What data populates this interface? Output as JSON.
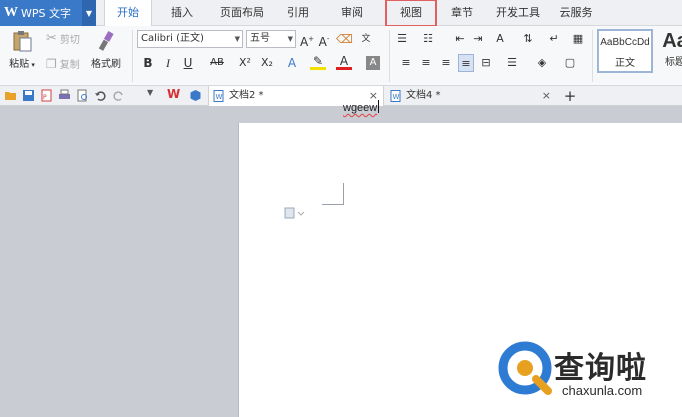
{
  "app": {
    "title": "WPS 文字",
    "logo_letter": "W"
  },
  "menu_tabs": [
    "开始",
    "插入",
    "页面布局",
    "引用",
    "审阅",
    "视图",
    "章节",
    "开发工具",
    "云服务"
  ],
  "active_tab": "开始",
  "highlighted_tab": "视图",
  "ribbon": {
    "paste": "粘贴",
    "cut": "剪切",
    "copy": "复制",
    "format_painter": "格式刷",
    "font_name": "Calibri (正文)",
    "font_size": "五号",
    "bold": "B",
    "italic": "I",
    "underline": "U",
    "strike": "AB",
    "superscript": "X²",
    "subscript": "X₂",
    "styles": [
      {
        "sample": "AaBbCcDd",
        "name": "正文"
      },
      {
        "sample": "Aa",
        "name": "标题"
      }
    ]
  },
  "documents": [
    {
      "name": "文档2 *",
      "active": true
    },
    {
      "name": "文档4 *",
      "active": false
    }
  ],
  "new_tab": "+",
  "close_symbol": "×",
  "document": {
    "text": "wgeew"
  },
  "watermark": {
    "text": "查询啦",
    "url": "chaxunla.com"
  },
  "colors": {
    "accent": "#3a78c8",
    "tab_active_text": "#2a6fc9",
    "highlight_box": "#e06060"
  }
}
